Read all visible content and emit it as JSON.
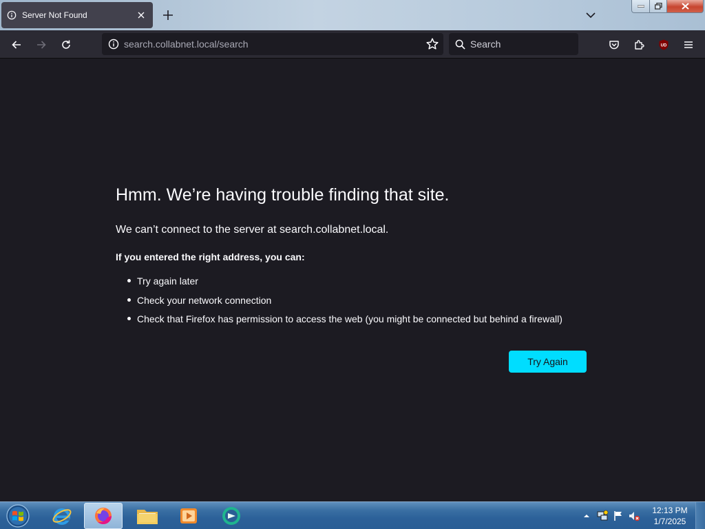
{
  "browser": {
    "tab": {
      "title": "Server Not Found"
    },
    "url": {
      "host": "search.collabnet.local",
      "path": "/search"
    },
    "search": {
      "placeholder": "Search"
    }
  },
  "error_page": {
    "title": "Hmm. We’re having trouble finding that site.",
    "description": "We can’t connect to the server at search.collabnet.local.",
    "subheading": "If you entered the right address, you can:",
    "suggestions": [
      "Try again later",
      "Check your network connection",
      "Check that Firefox has permission to access the web (you might be connected but behind a firewall)"
    ],
    "try_again_label": "Try Again"
  },
  "taskbar": {
    "apps": [
      "internet-explorer",
      "firefox",
      "file-explorer",
      "media-player",
      "messenger"
    ],
    "clock": {
      "time": "12:13 PM",
      "date": "1/7/2025"
    }
  },
  "colors": {
    "page_background": "#1c1b22",
    "toolbar_background": "#2b2a33",
    "accent_button": "#00ddff",
    "text": "#fbfbfe"
  }
}
